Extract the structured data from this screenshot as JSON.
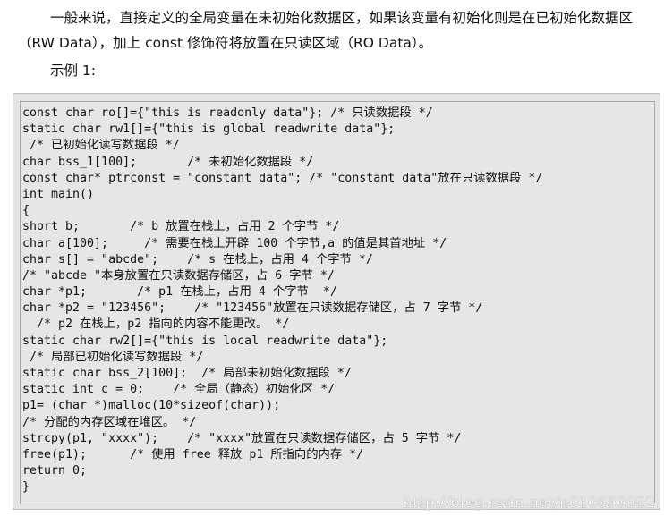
{
  "paragraph": {
    "text": "一般来说，直接定义的全局变量在未初始化数据区，如果该变量有初始化则是在已初始化数据区（RW Data），加上 const 修饰符将放置在只读区域（RO Data）。"
  },
  "example_label": "示例 1:",
  "code_lines": [
    "const char ro[]={\"this is readonly data\"}; /* 只读数据段 */",
    "static char rw1[]={\"this is global readwrite data\"};",
    " /* 已初始化读写数据段 */",
    "char bss_1[100];       /* 未初始化数据段 */",
    "const char* ptrconst = \"constant data\"; /* \"constant data\"放在只读数据段 */",
    "int main()",
    "{",
    "short b;       /* b 放置在栈上，占用 2 个字节 */",
    "char a[100];     /* 需要在栈上开辟 100 个字节,a 的值是其首地址 */",
    "char s[] = \"abcde\";    /* s 在栈上，占用 4 个字节 */",
    "/* \"abcde \"本身放置在只读数据存储区，占 6 字节 */",
    "char *p1;       /* p1 在栈上，占用 4 个字节  */",
    "char *p2 = \"123456\";    /* \"123456\"放置在只读数据存储区，占 7 字节 */",
    "  /* p2 在栈上，p2 指向的内容不能更改。 */",
    "static char rw2[]={\"this is local readwrite data\"};",
    " /* 局部已初始化读写数据段 */",
    "static char bss_2[100];  /* 局部未初始化数据段 */",
    "static int c = 0;    /* 全局（静态）初始化区 */",
    "p1= (char *)malloc(10*sizeof(char));",
    "/* 分配的内存区域在堆区。 */",
    "strcpy(p1, \"xxxx\");    /* \"xxxx\"放置在只读数据存储区，占 5 字节 */",
    "free(p1);      /* 使用 free 释放 p1 所指向的内存 */",
    "return 0;",
    "}"
  ],
  "watermark": "http://blog.csdn.net/u010550992"
}
